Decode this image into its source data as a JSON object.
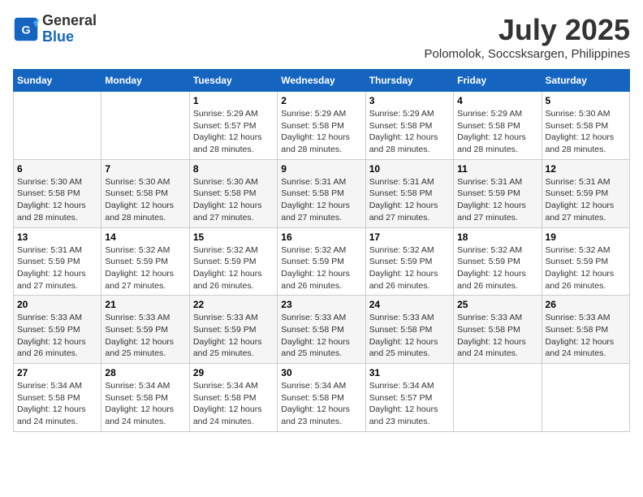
{
  "logo": {
    "line1": "General",
    "line2": "Blue"
  },
  "title": "July 2025",
  "location": "Polomolok, Soccsksargen, Philippines",
  "weekdays": [
    "Sunday",
    "Monday",
    "Tuesday",
    "Wednesday",
    "Thursday",
    "Friday",
    "Saturday"
  ],
  "weeks": [
    [
      {
        "day": "",
        "info": ""
      },
      {
        "day": "",
        "info": ""
      },
      {
        "day": "1",
        "info": "Sunrise: 5:29 AM\nSunset: 5:57 PM\nDaylight: 12 hours and 28 minutes."
      },
      {
        "day": "2",
        "info": "Sunrise: 5:29 AM\nSunset: 5:58 PM\nDaylight: 12 hours and 28 minutes."
      },
      {
        "day": "3",
        "info": "Sunrise: 5:29 AM\nSunset: 5:58 PM\nDaylight: 12 hours and 28 minutes."
      },
      {
        "day": "4",
        "info": "Sunrise: 5:29 AM\nSunset: 5:58 PM\nDaylight: 12 hours and 28 minutes."
      },
      {
        "day": "5",
        "info": "Sunrise: 5:30 AM\nSunset: 5:58 PM\nDaylight: 12 hours and 28 minutes."
      }
    ],
    [
      {
        "day": "6",
        "info": "Sunrise: 5:30 AM\nSunset: 5:58 PM\nDaylight: 12 hours and 28 minutes."
      },
      {
        "day": "7",
        "info": "Sunrise: 5:30 AM\nSunset: 5:58 PM\nDaylight: 12 hours and 28 minutes."
      },
      {
        "day": "8",
        "info": "Sunrise: 5:30 AM\nSunset: 5:58 PM\nDaylight: 12 hours and 27 minutes."
      },
      {
        "day": "9",
        "info": "Sunrise: 5:31 AM\nSunset: 5:58 PM\nDaylight: 12 hours and 27 minutes."
      },
      {
        "day": "10",
        "info": "Sunrise: 5:31 AM\nSunset: 5:58 PM\nDaylight: 12 hours and 27 minutes."
      },
      {
        "day": "11",
        "info": "Sunrise: 5:31 AM\nSunset: 5:59 PM\nDaylight: 12 hours and 27 minutes."
      },
      {
        "day": "12",
        "info": "Sunrise: 5:31 AM\nSunset: 5:59 PM\nDaylight: 12 hours and 27 minutes."
      }
    ],
    [
      {
        "day": "13",
        "info": "Sunrise: 5:31 AM\nSunset: 5:59 PM\nDaylight: 12 hours and 27 minutes."
      },
      {
        "day": "14",
        "info": "Sunrise: 5:32 AM\nSunset: 5:59 PM\nDaylight: 12 hours and 27 minutes."
      },
      {
        "day": "15",
        "info": "Sunrise: 5:32 AM\nSunset: 5:59 PM\nDaylight: 12 hours and 26 minutes."
      },
      {
        "day": "16",
        "info": "Sunrise: 5:32 AM\nSunset: 5:59 PM\nDaylight: 12 hours and 26 minutes."
      },
      {
        "day": "17",
        "info": "Sunrise: 5:32 AM\nSunset: 5:59 PM\nDaylight: 12 hours and 26 minutes."
      },
      {
        "day": "18",
        "info": "Sunrise: 5:32 AM\nSunset: 5:59 PM\nDaylight: 12 hours and 26 minutes."
      },
      {
        "day": "19",
        "info": "Sunrise: 5:32 AM\nSunset: 5:59 PM\nDaylight: 12 hours and 26 minutes."
      }
    ],
    [
      {
        "day": "20",
        "info": "Sunrise: 5:33 AM\nSunset: 5:59 PM\nDaylight: 12 hours and 26 minutes."
      },
      {
        "day": "21",
        "info": "Sunrise: 5:33 AM\nSunset: 5:59 PM\nDaylight: 12 hours and 25 minutes."
      },
      {
        "day": "22",
        "info": "Sunrise: 5:33 AM\nSunset: 5:59 PM\nDaylight: 12 hours and 25 minutes."
      },
      {
        "day": "23",
        "info": "Sunrise: 5:33 AM\nSunset: 5:58 PM\nDaylight: 12 hours and 25 minutes."
      },
      {
        "day": "24",
        "info": "Sunrise: 5:33 AM\nSunset: 5:58 PM\nDaylight: 12 hours and 25 minutes."
      },
      {
        "day": "25",
        "info": "Sunrise: 5:33 AM\nSunset: 5:58 PM\nDaylight: 12 hours and 24 minutes."
      },
      {
        "day": "26",
        "info": "Sunrise: 5:33 AM\nSunset: 5:58 PM\nDaylight: 12 hours and 24 minutes."
      }
    ],
    [
      {
        "day": "27",
        "info": "Sunrise: 5:34 AM\nSunset: 5:58 PM\nDaylight: 12 hours and 24 minutes."
      },
      {
        "day": "28",
        "info": "Sunrise: 5:34 AM\nSunset: 5:58 PM\nDaylight: 12 hours and 24 minutes."
      },
      {
        "day": "29",
        "info": "Sunrise: 5:34 AM\nSunset: 5:58 PM\nDaylight: 12 hours and 24 minutes."
      },
      {
        "day": "30",
        "info": "Sunrise: 5:34 AM\nSunset: 5:58 PM\nDaylight: 12 hours and 23 minutes."
      },
      {
        "day": "31",
        "info": "Sunrise: 5:34 AM\nSunset: 5:57 PM\nDaylight: 12 hours and 23 minutes."
      },
      {
        "day": "",
        "info": ""
      },
      {
        "day": "",
        "info": ""
      }
    ]
  ]
}
